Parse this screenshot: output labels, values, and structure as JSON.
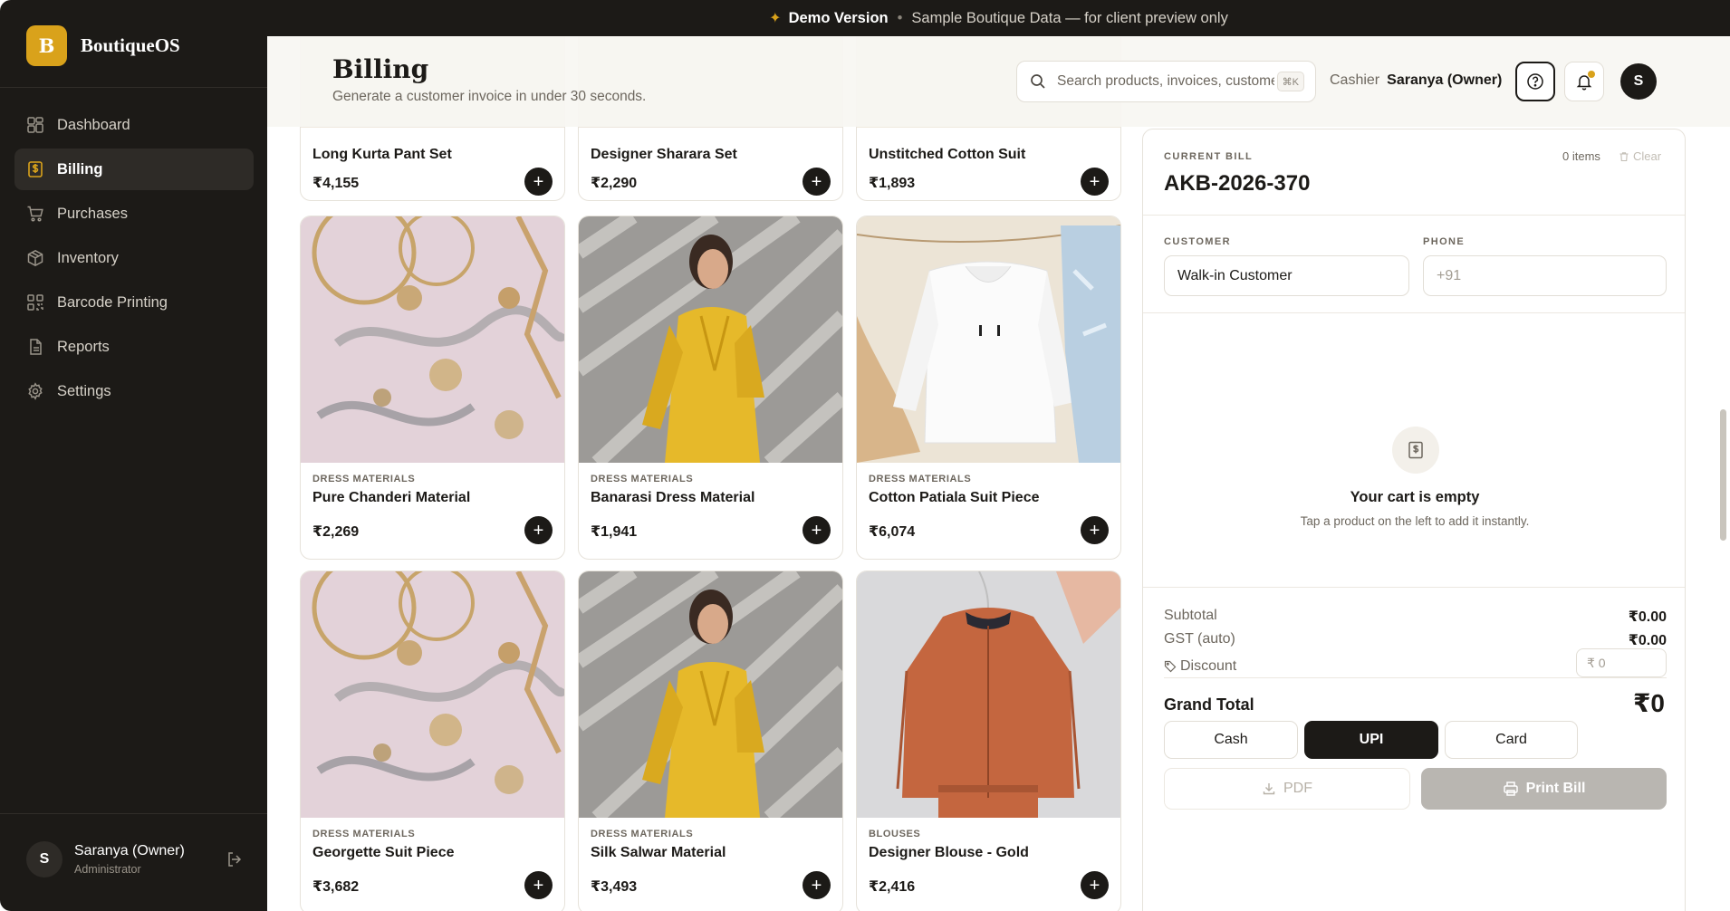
{
  "brand": {
    "logo_letter": "B",
    "name": "BoutiqueOS",
    "accent": "#d9a21b",
    "dark": "#1c1a17"
  },
  "nav": [
    {
      "label": "Dashboard",
      "icon": "dashboard-icon",
      "active": false
    },
    {
      "label": "Billing",
      "icon": "billing-icon",
      "active": true
    },
    {
      "label": "Purchases",
      "icon": "cart-icon",
      "active": false
    },
    {
      "label": "Inventory",
      "icon": "box-icon",
      "active": false
    },
    {
      "label": "Barcode Printing",
      "icon": "barcode-icon",
      "active": false
    },
    {
      "label": "Reports",
      "icon": "report-icon",
      "active": false
    },
    {
      "label": "Settings",
      "icon": "gear-icon",
      "active": false
    }
  ],
  "user": {
    "initial": "S",
    "name": "Saranya (Owner)",
    "role": "Administrator"
  },
  "banner": {
    "demo": "Demo Version",
    "text": "Sample Boutique Data — for client preview only"
  },
  "header": {
    "title": "Billing",
    "subtitle": "Generate a customer invoice in under 30 seconds.",
    "search_placeholder": "Search products, invoices, customers",
    "shortcut": "⌘K",
    "cashier_label": "Cashier",
    "cashier_name": "Saranya (Owner)",
    "avatar": "S"
  },
  "products": [
    {
      "category": "",
      "name": "Long Kurta Pant Set",
      "price": "₹4,155",
      "image": "partial"
    },
    {
      "category": "",
      "name": "Designer Sharara Set",
      "price": "₹2,290",
      "image": "partial"
    },
    {
      "category": "",
      "name": "Unstitched Cotton Suit",
      "price": "₹1,893",
      "image": "partial"
    },
    {
      "category": "DRESS MATERIALS",
      "name": "Pure Chanderi Material",
      "price": "₹2,269",
      "image": "jewelry"
    },
    {
      "category": "DRESS MATERIALS",
      "name": "Banarasi Dress Material",
      "price": "₹1,941",
      "image": "yellow-dress"
    },
    {
      "category": "DRESS MATERIALS",
      "name": "Cotton Patiala Suit Piece",
      "price": "₹6,074",
      "image": "hoodie"
    },
    {
      "category": "DRESS MATERIALS",
      "name": "Georgette Suit Piece",
      "price": "₹3,682",
      "image": "jewelry"
    },
    {
      "category": "DRESS MATERIALS",
      "name": "Silk Salwar Material",
      "price": "₹3,493",
      "image": "yellow-dress"
    },
    {
      "category": "BLOUSES",
      "name": "Designer Blouse - Gold",
      "price": "₹2,416",
      "image": "jacket"
    }
  ],
  "bill": {
    "label": "CURRENT BILL",
    "number": "AKB-2026-370",
    "items_count": "0 items",
    "clear_label": "Clear",
    "customer_label": "CUSTOMER",
    "customer_value": "Walk-in Customer",
    "phone_label": "PHONE",
    "phone_placeholder": "+91",
    "empty_title": "Your cart is empty",
    "empty_sub": "Tap a product on the left to add it instantly.",
    "subtotal_label": "Subtotal",
    "subtotal_value": "₹0.00",
    "gst_label": "GST (auto)",
    "gst_value": "₹0.00",
    "discount_label": "Discount",
    "discount_placeholder": "₹ 0",
    "grand_total_label": "Grand Total",
    "grand_total_value": "₹0",
    "payment_methods": [
      "Cash",
      "UPI",
      "Card"
    ],
    "selected_payment": "UPI",
    "pdf_label": "PDF",
    "print_label": "Print Bill"
  }
}
